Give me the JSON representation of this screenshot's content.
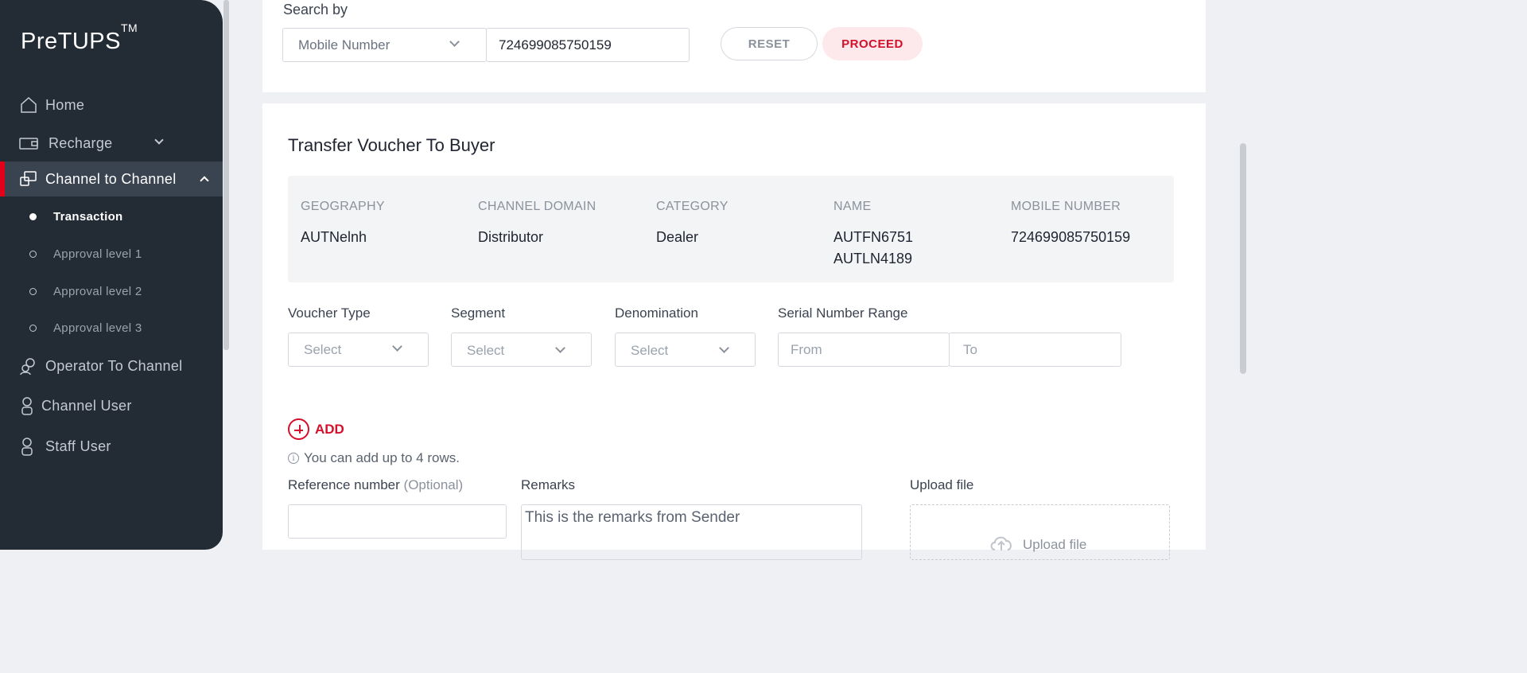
{
  "brand": {
    "name": "PreTUPS",
    "tm": "TM"
  },
  "sidebar": {
    "items": [
      {
        "label": "Home",
        "icon": "home-icon"
      },
      {
        "label": "Recharge",
        "icon": "wallet-icon"
      },
      {
        "label": "Channel to Channel",
        "icon": "transfer-icon"
      },
      {
        "label": "Operator To Channel",
        "icon": "operator-icon"
      },
      {
        "label": "Channel User",
        "icon": "user-icon"
      },
      {
        "label": "Staff User",
        "icon": "user-icon"
      }
    ],
    "subitems": [
      {
        "label": "Transaction"
      },
      {
        "label": "Approval level 1"
      },
      {
        "label": "Approval level 2"
      },
      {
        "label": "Approval level 3"
      }
    ]
  },
  "search": {
    "label": "Search by",
    "type_value": "Mobile Number",
    "query_value": "724699085750159",
    "reset_label": "RESET",
    "proceed_label": "PROCEED"
  },
  "transfer": {
    "title": "Transfer Voucher To Buyer",
    "info": {
      "geography": {
        "header": "GEOGRAPHY",
        "value": "AUTNelnh"
      },
      "domain": {
        "header": "CHANNEL DOMAIN",
        "value": "Distributor"
      },
      "category": {
        "header": "CATEGORY",
        "value": "Dealer"
      },
      "name": {
        "header": "NAME",
        "value1": "AUTFN6751",
        "value2": "AUTLN4189"
      },
      "mobile": {
        "header": "MOBILE NUMBER",
        "value": "724699085750159"
      }
    },
    "fields": {
      "voucher_type": {
        "label": "Voucher Type",
        "placeholder": "Select"
      },
      "segment": {
        "label": "Segment",
        "placeholder": "Select"
      },
      "denomination": {
        "label": "Denomination",
        "placeholder": "Select"
      },
      "serial_range": {
        "label": "Serial Number Range",
        "from_placeholder": "From",
        "to_placeholder": "To"
      }
    },
    "add_label": "ADD",
    "hint": "You can add up to 4 rows.",
    "reference": {
      "label": "Reference number",
      "optional": "(Optional)"
    },
    "remarks": {
      "label": "Remarks",
      "value": "This is the remarks from Sender"
    },
    "upload": {
      "label": "Upload file",
      "button": "Upload file"
    }
  },
  "colors": {
    "sidebar_bg": "#232b35",
    "accent": "#e2001a",
    "proceed_bg": "#fde8eb"
  }
}
